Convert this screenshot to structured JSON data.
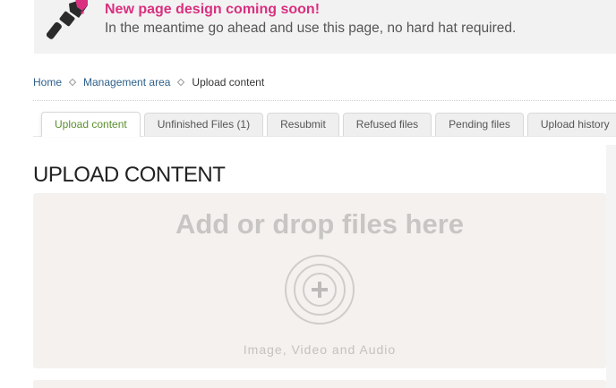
{
  "banner": {
    "title": "New page design coming soon!",
    "message": "In the meantime go ahead and use this page, no hard hat required.",
    "icon": "paintbrush-icon",
    "accent_color": "#d9307f"
  },
  "breadcrumb": [
    {
      "label": "Home"
    },
    {
      "label": "Management area"
    },
    {
      "label": "Upload content"
    }
  ],
  "tabs": [
    {
      "label": "Upload content",
      "active": true
    },
    {
      "label": "Unfinished Files (1)",
      "active": false
    },
    {
      "label": "Resubmit",
      "active": false
    },
    {
      "label": "Refused files",
      "active": false
    },
    {
      "label": "Pending files",
      "active": false
    },
    {
      "label": "Upload history",
      "active": false
    }
  ],
  "main": {
    "title": "UPLOAD CONTENT",
    "dropzone": {
      "title": "Add or drop files here",
      "hint": "Image, Video and Audio",
      "icon": "add-circle-icon"
    }
  },
  "colors": {
    "active_tab_text": "#5a8f2c",
    "link": "#2d5f8a"
  }
}
